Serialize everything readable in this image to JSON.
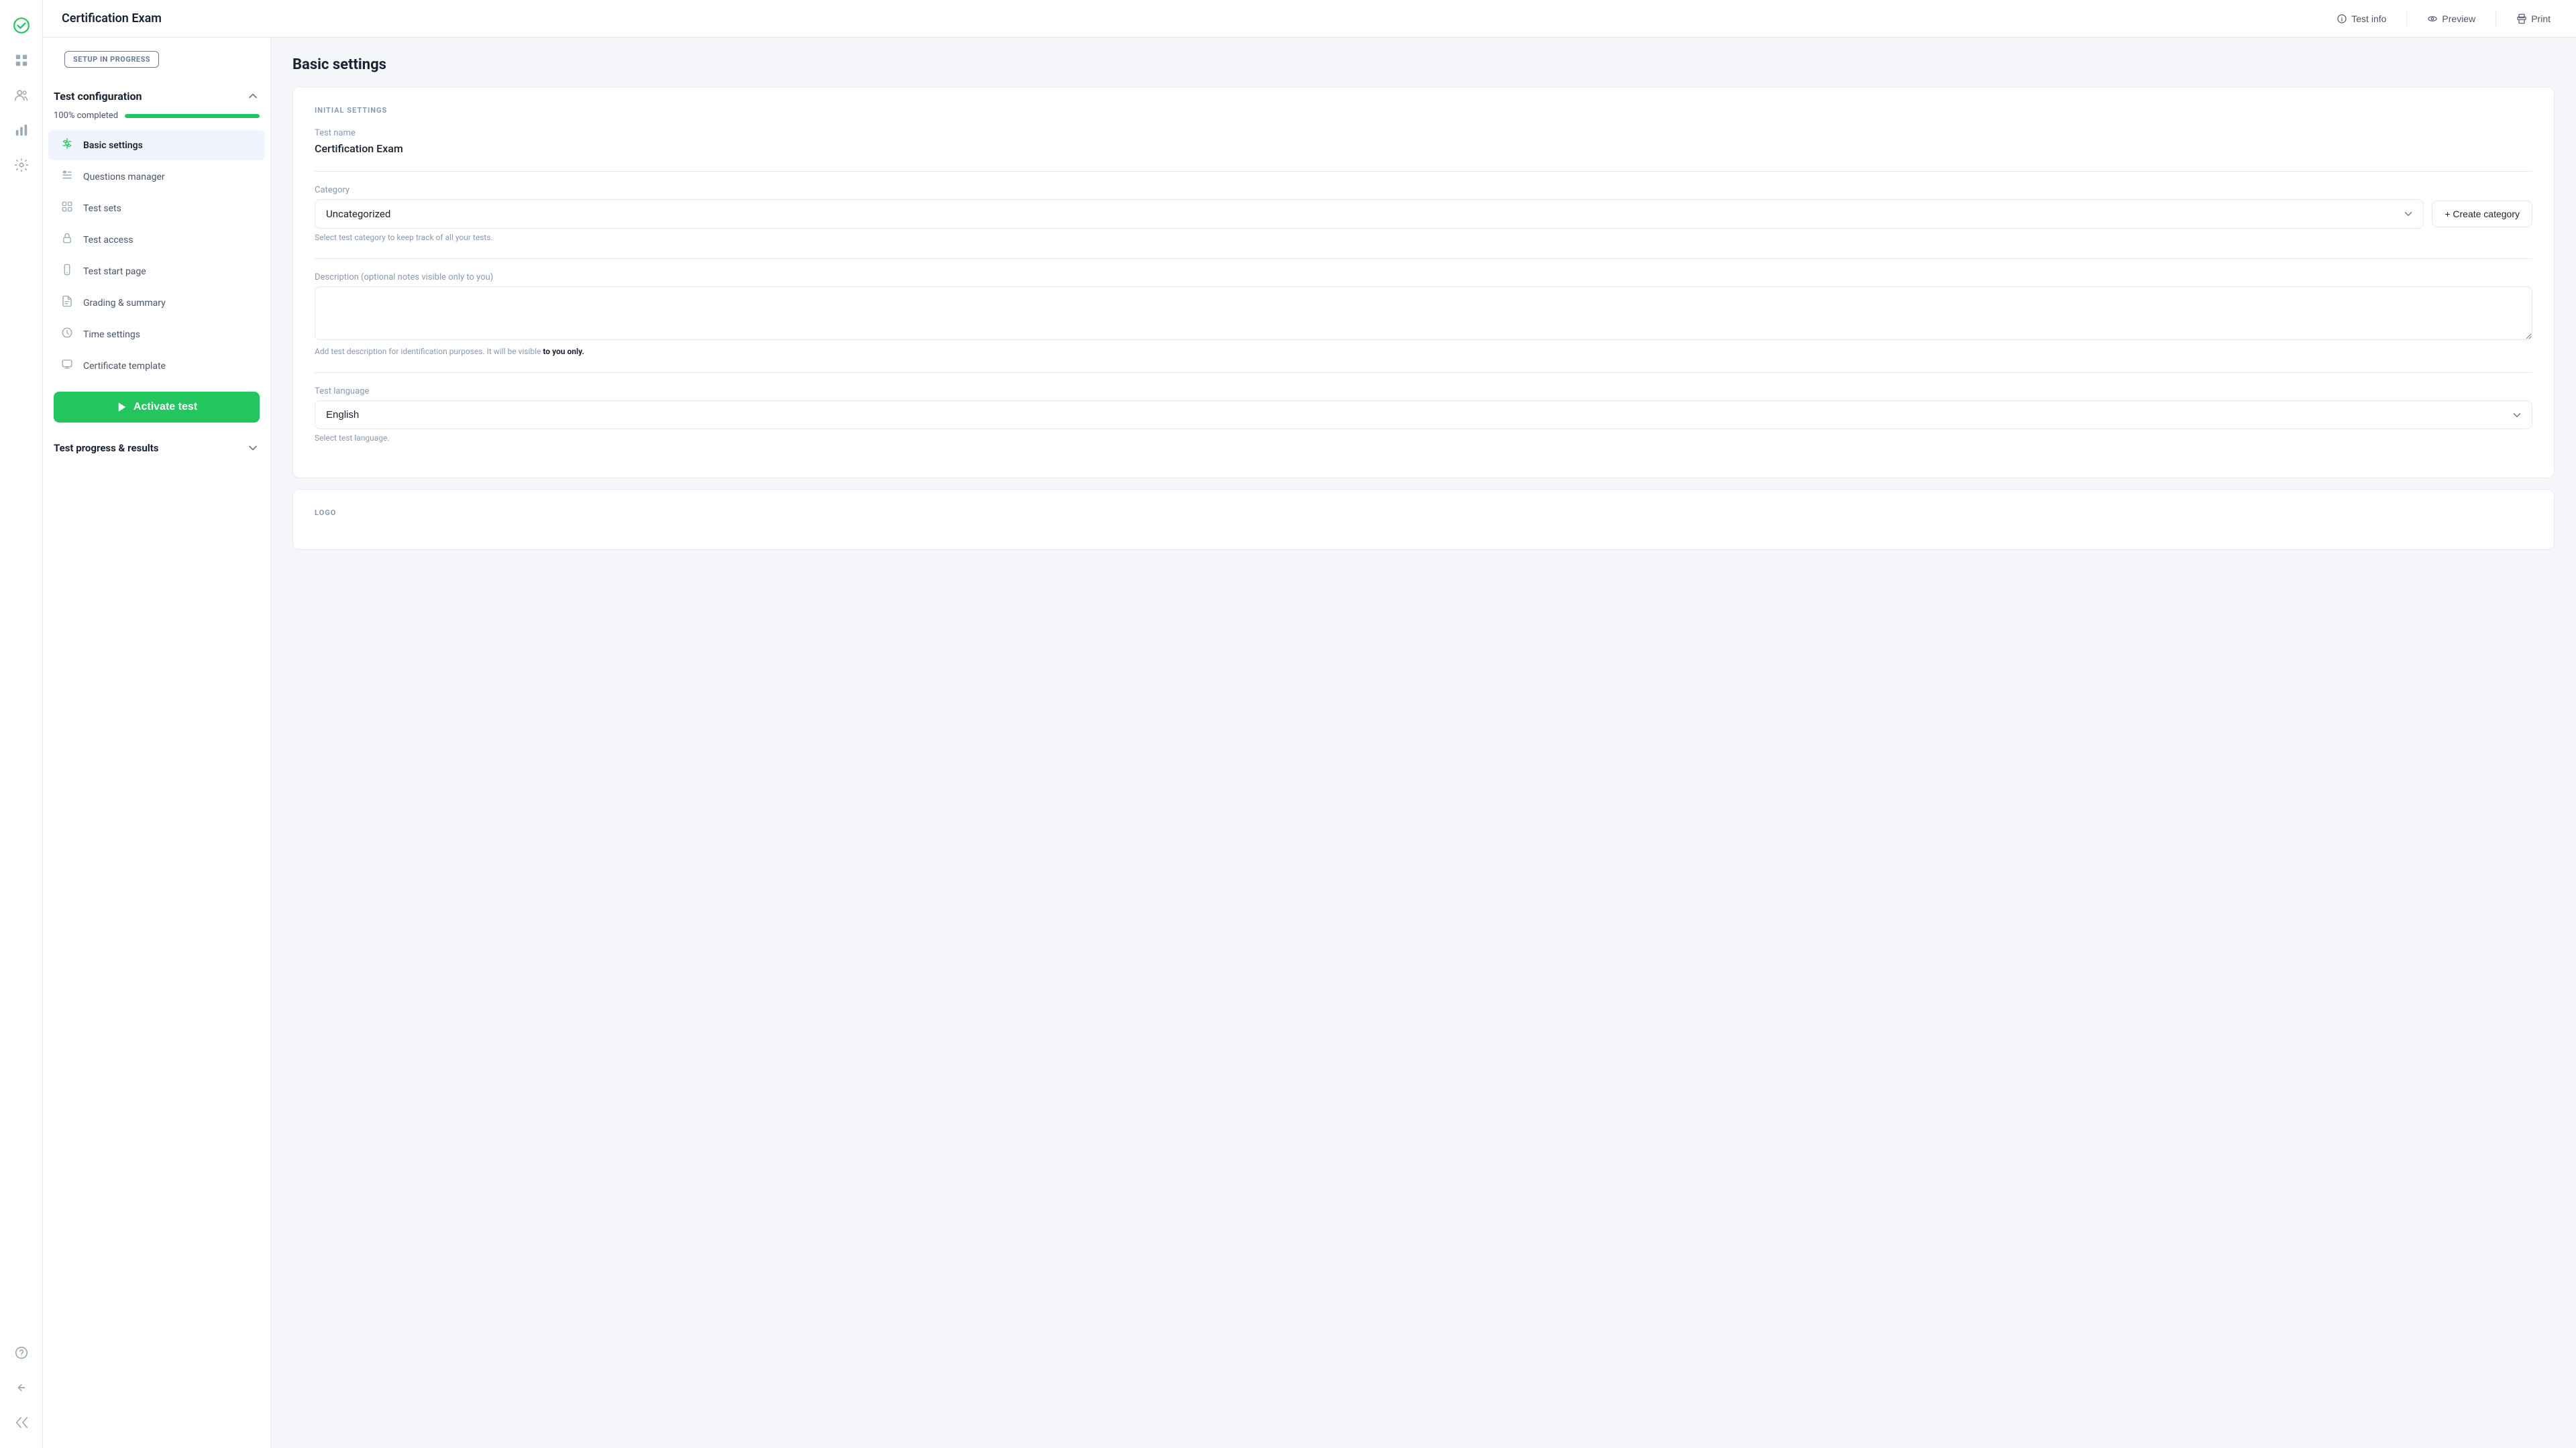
{
  "app": {
    "logo_icon": "check-circle-icon"
  },
  "header": {
    "title": "Certification Exam",
    "actions": [
      {
        "id": "test-info",
        "icon": "info-icon",
        "label": "Test info"
      },
      {
        "id": "preview",
        "icon": "eye-icon",
        "label": "Preview"
      },
      {
        "id": "print",
        "icon": "print-icon",
        "label": "Print"
      }
    ]
  },
  "icon_sidebar": {
    "items": [
      {
        "id": "logo",
        "icon": "check-icon",
        "active": true
      },
      {
        "id": "grid",
        "icon": "grid-icon"
      },
      {
        "id": "users",
        "icon": "users-icon"
      },
      {
        "id": "chart",
        "icon": "chart-icon"
      },
      {
        "id": "gear",
        "icon": "gear-icon"
      }
    ],
    "bottom": [
      {
        "id": "help",
        "icon": "help-icon"
      },
      {
        "id": "back",
        "icon": "back-icon"
      },
      {
        "id": "collapse",
        "icon": "collapse-icon"
      }
    ]
  },
  "config_sidebar": {
    "setup_badge": "SETUP IN PROGRESS",
    "section1": {
      "title": "Test configuration",
      "progress_label": "100% completed",
      "progress_value": 100,
      "nav_items": [
        {
          "id": "basic-settings",
          "icon": "sliders-icon",
          "label": "Basic settings",
          "active": true
        },
        {
          "id": "questions-manager",
          "icon": "list-icon",
          "label": "Questions manager"
        },
        {
          "id": "test-sets",
          "icon": "grid2-icon",
          "label": "Test sets"
        },
        {
          "id": "test-access",
          "icon": "lock-icon",
          "label": "Test access"
        },
        {
          "id": "test-start-page",
          "icon": "phone-icon",
          "label": "Test start page"
        },
        {
          "id": "grading-summary",
          "icon": "file-icon",
          "label": "Grading & summary"
        },
        {
          "id": "time-settings",
          "icon": "clock-icon",
          "label": "Time settings"
        },
        {
          "id": "certificate-template",
          "icon": "badge-icon",
          "label": "Certificate template"
        }
      ],
      "activate_button": "Activate test"
    },
    "section2": {
      "title": "Test progress & results"
    }
  },
  "main": {
    "page_title": "Basic settings",
    "card1": {
      "section_label": "INITIAL SETTINGS",
      "test_name_label": "Test name",
      "test_name_value": "Certification Exam",
      "category_label": "Category",
      "category_value": "Uncategorized",
      "category_hint": "Select test category to keep track of all your tests.",
      "create_category_label": "+ Create category",
      "description_label": "Description (optional notes visible only to you)",
      "description_value": "",
      "description_hint_prefix": "Add test description for identification purposes. It will be visible ",
      "description_hint_bold": "to you only.",
      "language_label": "Test language",
      "language_value": "English",
      "language_hint": "Select test language."
    },
    "card2": {
      "section_label": "LOGO"
    }
  }
}
